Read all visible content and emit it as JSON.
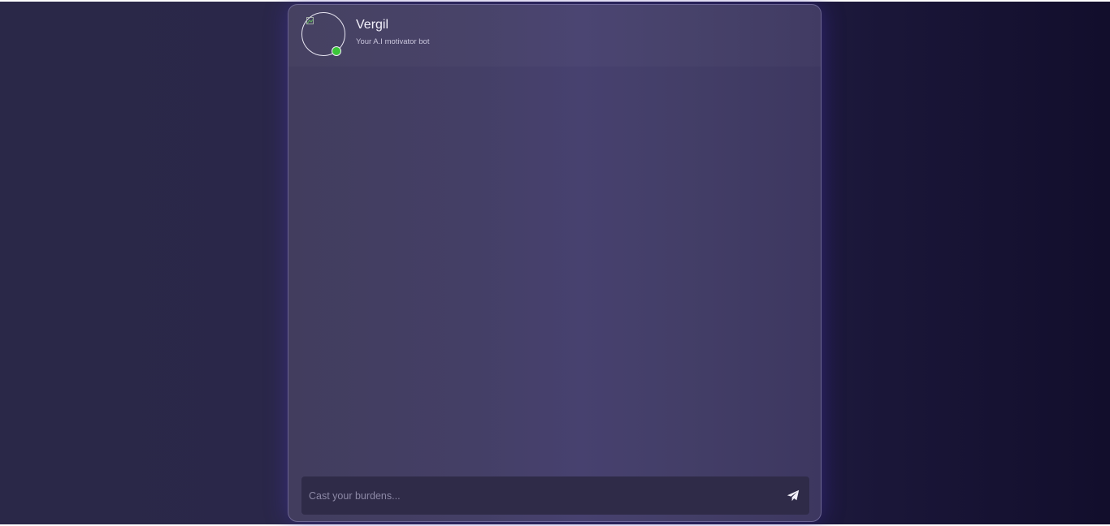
{
  "bot": {
    "name": "Vergil",
    "subtitle": "Your A.I motivator bot",
    "status": "online",
    "status_color": "#3cc53a",
    "avatar_icon": "broken-image-icon"
  },
  "composer": {
    "placeholder": "Cast your burdens...",
    "value": "",
    "send_icon": "paper-plane-icon"
  },
  "messages": [],
  "theme": {
    "background": "#221f44",
    "panel": "#443f66",
    "input": "#2f2b48",
    "accent_glow": "#4632b4"
  }
}
